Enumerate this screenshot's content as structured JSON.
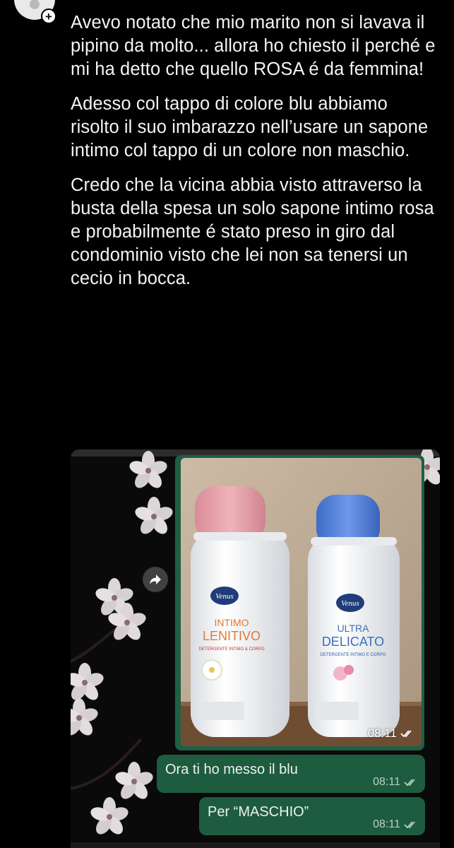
{
  "post": {
    "paragraphs": [
      "Avevo notato che mio marito non si lavava il pipino da molto... allora ho chiesto il perché e mi ha detto che quello ROSA é da femmina!",
      "Adesso col tappo di colore blu abbiamo risolto il suo imbarazzo nell’usare un sapone intimo col tappo di un colore non maschio.",
      "Credo che la vicina abbia visto attraverso la busta della spesa un solo sapone intimo rosa e probabilmente é stato preso in giro dal condominio visto che lei non sa tenersi un cecio in bocca."
    ]
  },
  "screenshot": {
    "photo": {
      "bottle_left": {
        "brand": "Venus",
        "line1": "INTIMO",
        "line2": "LENITIVO",
        "sub": "DETERGENTE INTIMO & CORPO",
        "cap_color": "#e7a0a8"
      },
      "bottle_right": {
        "brand": "Venus",
        "line1": "ULTRA",
        "line2": "DELICATO",
        "sub": "DETERGENTE INTIMO E CORPO",
        "cap_color": "#4f7fd6"
      },
      "time": "08:11"
    },
    "messages": [
      {
        "text": "Ora ti ho messo il blu",
        "time": "08:11"
      },
      {
        "text": "Per “MASCHIO”",
        "time": "08:11"
      }
    ]
  },
  "colors": {
    "background": "#000000",
    "bubble_green": "#1d5c3f",
    "text": "#f4f4f4"
  },
  "icons": {
    "avatar": "person-avatar-icon",
    "add_badge": "plus-icon",
    "forward": "forward-arrow-icon",
    "read_receipt": "double-check-icon"
  }
}
